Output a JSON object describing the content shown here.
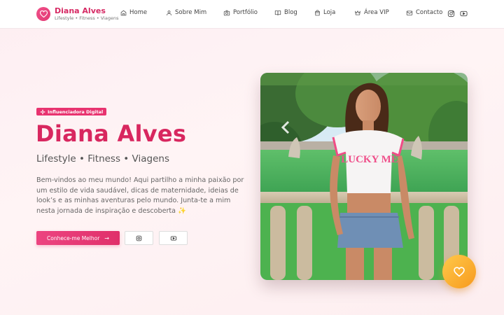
{
  "brand": {
    "name": "Diana Alves",
    "tagline": "Lifestyle • Fitness • Viagens"
  },
  "nav": {
    "items": [
      {
        "label": "Home",
        "icon": "home-icon"
      },
      {
        "label": "Sobre Mim",
        "icon": "user-icon"
      },
      {
        "label": "Portfólio",
        "icon": "camera-icon"
      },
      {
        "label": "Blog",
        "icon": "book-icon"
      },
      {
        "label": "Loja",
        "icon": "shopping-bag-icon"
      },
      {
        "label": "Área VIP",
        "icon": "crown-icon"
      },
      {
        "label": "Contacto",
        "icon": "mail-icon"
      }
    ],
    "social": [
      "instagram-icon",
      "youtube-icon"
    ]
  },
  "hero": {
    "badge": "Influenciadora Digital",
    "name": "Diana Alves",
    "subtitle": "Lifestyle • Fitness • Viagens",
    "description": "Bem-vindos ao meu mundo! Aqui partilho a minha paixão por um estilo de vida saudável, dicas de maternidade, ideias de look’s e as minhas aventuras pelo mundo. Junta-te a mim nesta jornada de inspiração e descoberta ✨",
    "cta_label": "Conhece-me Melhor",
    "cta_arrow": "→",
    "photo_shirt_text": "LUCKY ME"
  },
  "colors": {
    "brand": "#d8275f",
    "accent": "#e8336f",
    "fab": "#f9ab2e"
  }
}
